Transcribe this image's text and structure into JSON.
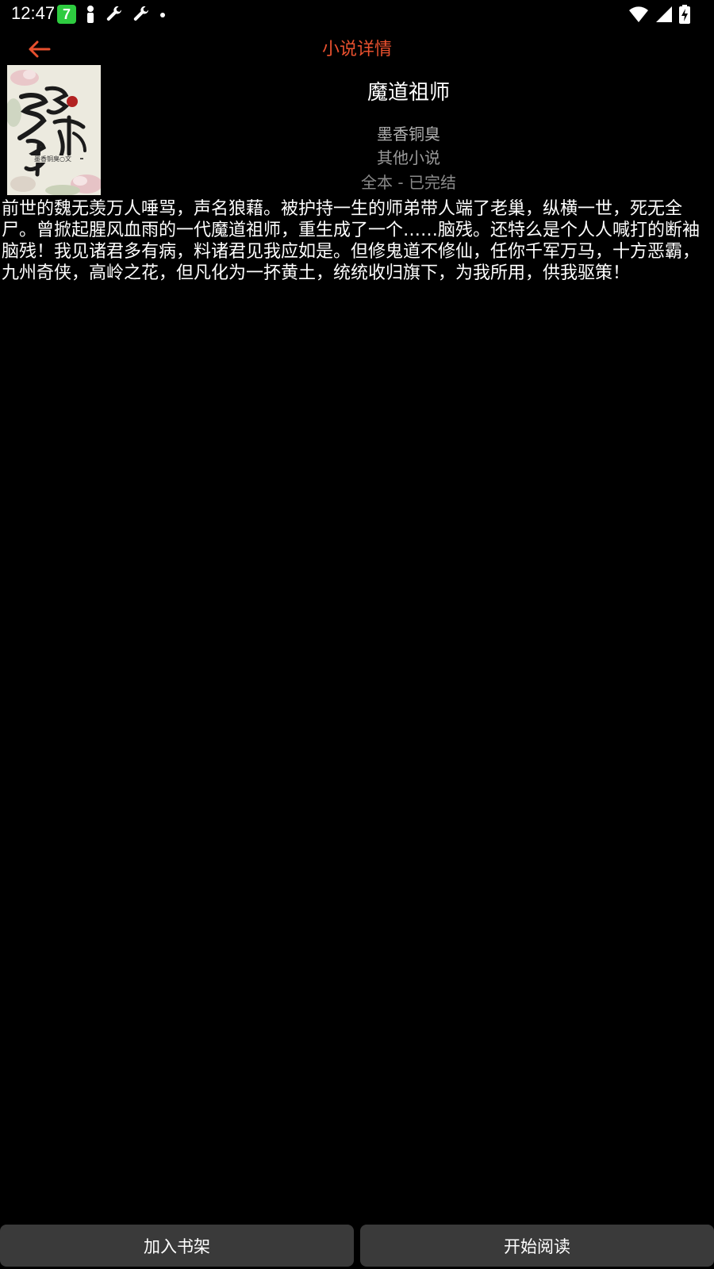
{
  "status_bar": {
    "time": "12:47",
    "app_badge": "7",
    "left_icons": [
      "app-7-icon",
      "person-icon",
      "wrench-icon",
      "wrench-icon",
      "dot-icon"
    ],
    "right_icons": [
      "wifi-icon",
      "cell-signal-icon",
      "battery-charging-icon"
    ]
  },
  "header": {
    "title": "小说详情",
    "back_icon": "arrow-left-icon",
    "accent_color": "#e8502e"
  },
  "book": {
    "title": "魔道祖师",
    "author": "墨香铜臭",
    "category": "其他小说",
    "status": "全本 - 已完结",
    "description": "前世的魏无羡万人唾骂，声名狼藉。被护持一生的师弟带人端了老巢，纵横一世，死无全尸。曾掀起腥风血雨的一代魔道祖师，重生成了一个……脑残。还特么是个人人喊打的断袖脑残！我见诸君多有病，料诸君见我应如是。但修鬼道不修仙，任你千军万马，十方恶霸，九州奇侠，高岭之花，但凡化为一抔黄土，统统收归旗下，为我所用，供我驱策！"
  },
  "actions": {
    "add_to_shelf": "加入书架",
    "start_reading": "开始阅读"
  }
}
